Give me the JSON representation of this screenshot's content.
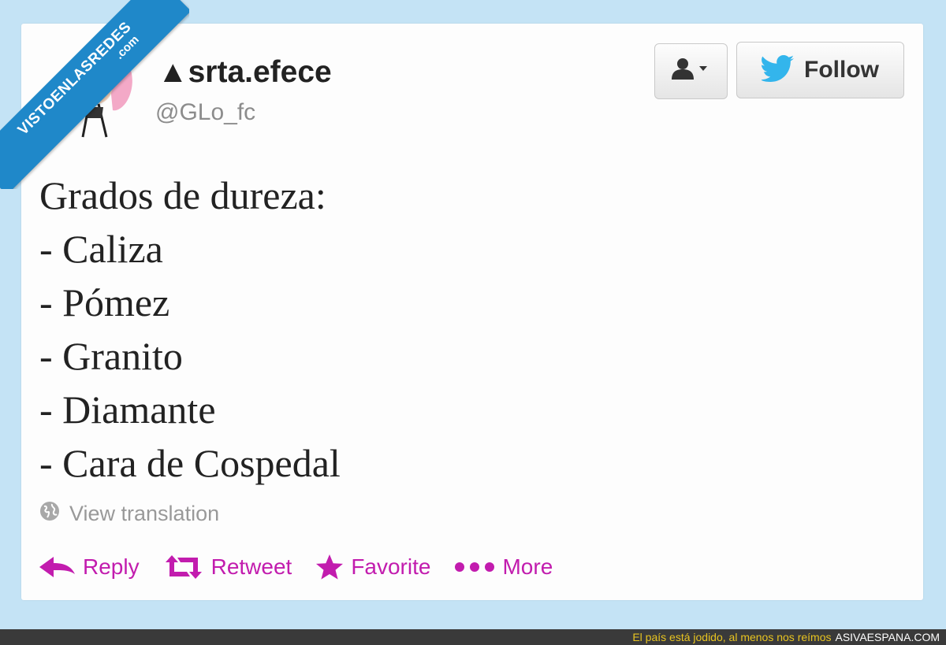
{
  "tweet": {
    "display_name": "▲srta.efece",
    "handle": "@GLo_fc",
    "lines": [
      "Grados de dureza:",
      "- Caliza",
      "- Pómez",
      "- Granito",
      "- Diamante",
      "- Cara de Cospedal"
    ],
    "translate_label": "View translation"
  },
  "header_buttons": {
    "user_menu_icon": "user-dropdown-icon",
    "follow_label": "Follow",
    "follow_icon": "twitter-bird-icon"
  },
  "actions": [
    {
      "label": "Reply",
      "icon": "reply-arrow-icon"
    },
    {
      "label": "Retweet",
      "icon": "retweet-icon"
    },
    {
      "label": "Favorite",
      "icon": "star-icon"
    },
    {
      "label": "More",
      "icon": "more-dots-icon"
    }
  ],
  "watermark": {
    "main": "VISTOENLASREDES",
    "sub": ".com"
  },
  "footer": {
    "tagline": "El país está jodido, al menos nos reímos",
    "site": "ASIVAESPANA.COM"
  },
  "colors": {
    "background": "#c4e3f5",
    "action_accent": "#c21cae",
    "twitter_blue": "#33b5ec",
    "ribbon": "#1f88c9",
    "footer_tagline": "#e8c420"
  }
}
